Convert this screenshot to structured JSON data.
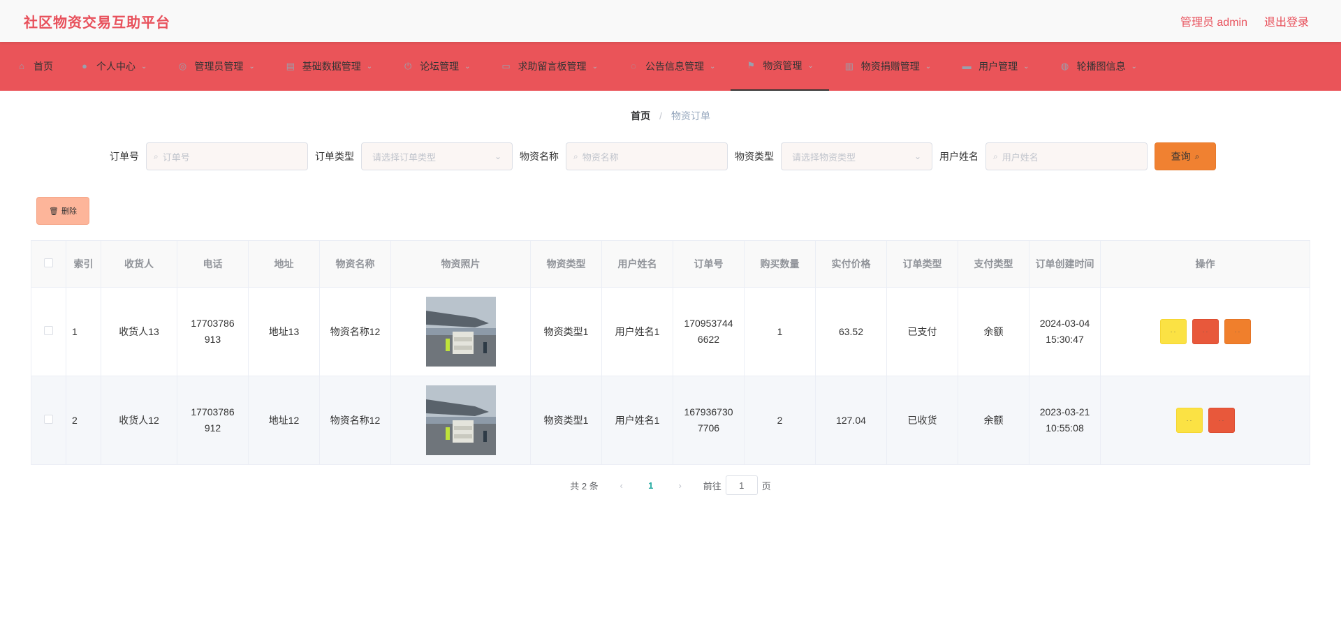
{
  "header": {
    "title": "社区物资交易互助平台",
    "user_label": "管理员 admin",
    "logout_label": "退出登录"
  },
  "nav": {
    "items": [
      {
        "label": "首页",
        "icon": "home-icon"
      },
      {
        "label": "个人中心",
        "icon": "user-icon"
      },
      {
        "label": "管理员管理",
        "icon": "admin-icon"
      },
      {
        "label": "基础数据管理",
        "icon": "data-icon"
      },
      {
        "label": "论坛管理",
        "icon": "power-icon"
      },
      {
        "label": "求助留言板管理",
        "icon": "message-icon"
      },
      {
        "label": "公告信息管理",
        "icon": "notice-icon"
      },
      {
        "label": "物资管理",
        "icon": "flag-icon"
      },
      {
        "label": "物资捐赠管理",
        "icon": "donation-icon"
      },
      {
        "label": "用户管理",
        "icon": "users-icon"
      },
      {
        "label": "轮播图信息",
        "icon": "carousel-icon"
      }
    ],
    "active_index": 7
  },
  "breadcrumb": {
    "home": "首页",
    "separator": "/",
    "current": "物资订单"
  },
  "search": {
    "order_no_label": "订单号",
    "order_no_placeholder": "订单号",
    "order_type_label": "订单类型",
    "order_type_placeholder": "请选择订单类型",
    "goods_name_label": "物资名称",
    "goods_name_placeholder": "物资名称",
    "goods_type_label": "物资类型",
    "goods_type_placeholder": "请选择物资类型",
    "user_name_label": "用户姓名",
    "user_name_placeholder": "用户姓名",
    "query_label": "查询"
  },
  "actions": {
    "delete_label": "删除"
  },
  "table": {
    "headers": [
      "索引",
      "收货人",
      "电话",
      "地址",
      "物资名称",
      "物资照片",
      "物资类型",
      "用户姓名",
      "订单号",
      "购买数量",
      "实付价格",
      "订单类型",
      "支付类型",
      "订单创建时间",
      "操作"
    ],
    "rows": [
      {
        "index": "1",
        "receiver": "收货人13",
        "phone": "17703786913",
        "address": "地址13",
        "goods_name": "物资名称12",
        "goods_type": "物资类型1",
        "user_name": "用户姓名1",
        "order_no": "1709537446622",
        "quantity": "1",
        "price": "63.52",
        "order_type": "已支付",
        "pay_type": "余额",
        "created": "2024-03-04 15:30:47",
        "op_buttons": 3
      },
      {
        "index": "2",
        "receiver": "收货人12",
        "phone": "17703786912",
        "address": "地址12",
        "goods_name": "物资名称12",
        "goods_type": "物资类型1",
        "user_name": "用户姓名1",
        "order_no": "1679367307706",
        "quantity": "2",
        "price": "127.04",
        "order_type": "已收货",
        "pay_type": "余额",
        "created": "2023-03-21 10:55:08",
        "op_buttons": 2
      }
    ],
    "op_button_text": "· ·"
  },
  "pagination": {
    "total": "共 2 条",
    "current_page": "1",
    "goto_prefix": "前往",
    "goto_value": "1",
    "goto_suffix": "页"
  },
  "colors": {
    "brand": "#e8505b",
    "nav_bg": "#ea5459",
    "query_btn": "#f08131",
    "delete_btn": "#fdb59a",
    "op_yellow": "#fbe244",
    "op_red": "#e8583b",
    "op_orange": "#f07f2c"
  }
}
